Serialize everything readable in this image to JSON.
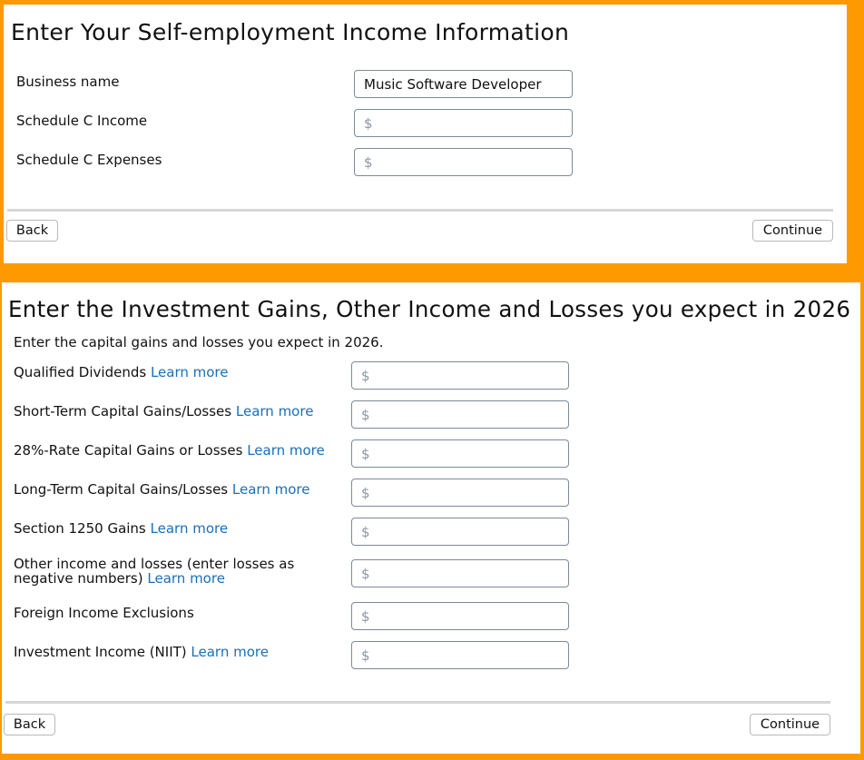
{
  "self_employment": {
    "title": "Enter Your Self-employment Income Information",
    "business_name_label": "Business name",
    "business_name_value": "Music Software Developer",
    "income_label": "Schedule C Income",
    "income_placeholder": "$",
    "expenses_label": "Schedule C Expenses",
    "expenses_placeholder": "$",
    "back_label": "Back",
    "continue_label": "Continue"
  },
  "investment": {
    "title": "Enter the Investment Gains, Other Income and Losses you expect in 2026",
    "intro": "Enter the capital gains and losses you expect in 2026.",
    "learn_more": "Learn more",
    "fields": [
      {
        "label": "Qualified Dividends",
        "placeholder": "$"
      },
      {
        "label": "Short-Term Capital Gains/Losses",
        "placeholder": "$"
      },
      {
        "label": "28%-Rate Capital Gains or Losses",
        "placeholder": "$"
      },
      {
        "label": "Long-Term Capital Gains/Losses",
        "placeholder": "$"
      },
      {
        "label": "Section 1250 Gains",
        "placeholder": "$"
      },
      {
        "label_line1": "Other income and losses (enter losses as",
        "label_line2": "negative numbers)",
        "placeholder": "$"
      },
      {
        "label": "Foreign Income Exclusions",
        "placeholder": "$"
      },
      {
        "label": "Investment Income (NIIT)",
        "placeholder": "$"
      }
    ],
    "back_label": "Back",
    "continue_label": "Continue"
  },
  "colors": {
    "frame": "#ff9900",
    "link": "#1a6fb8",
    "field_border": "#7a8a99",
    "divider": "#d6d6d6"
  }
}
